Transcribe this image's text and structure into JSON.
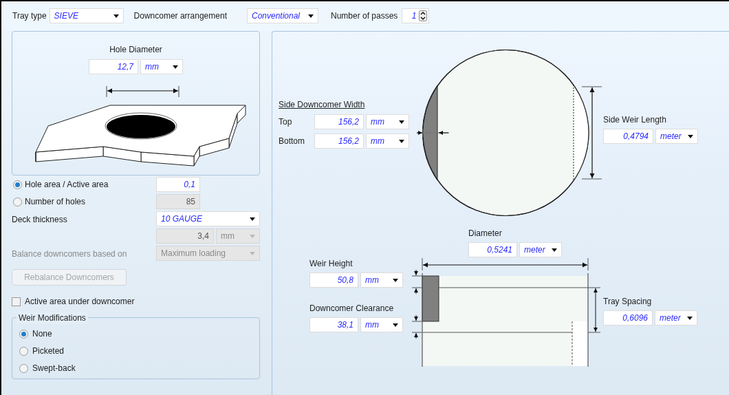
{
  "toolbar": {
    "tray_type": {
      "label": "Tray type",
      "value": "SIEVE"
    },
    "downcomer_arrangement": {
      "label": "Downcomer arrangement",
      "value": "Conventional"
    },
    "number_of_passes": {
      "label": "Number of passes",
      "value": "1"
    }
  },
  "hole_diameter": {
    "label": "Hole Diameter",
    "value": "12,7",
    "unit": "mm"
  },
  "hole_options": [
    {
      "label": "Hole area / Active area",
      "value": "0,1",
      "selected": true,
      "disabled": false
    },
    {
      "label": "Number of holes",
      "value": "85",
      "selected": false,
      "disabled": true
    }
  ],
  "deck_thickness": {
    "label": "Deck thickness",
    "value": "10 GAUGE",
    "thickness": {
      "value": "3,4",
      "unit": "mm",
      "disabled": true
    }
  },
  "balance": {
    "label": "Balance downcomers based on",
    "value": "Maximum loading",
    "disabled": true
  },
  "rebalance_button": {
    "label": "Rebalance Downcomers",
    "disabled": true
  },
  "active_area_under_downcomer": {
    "label": "Active area under downcomer",
    "checked": false
  },
  "weir_modifications": {
    "title": "Weir Modifications",
    "options": [
      {
        "label": "None",
        "selected": true
      },
      {
        "label": "Picketed",
        "selected": false
      },
      {
        "label": "Swept-back",
        "selected": false
      }
    ]
  },
  "side_downcomer_width": {
    "title": "Side Downcomer Width",
    "rows": [
      {
        "label": "Top",
        "value": "156,2",
        "unit": "mm"
      },
      {
        "label": "Bottom",
        "value": "156,2",
        "unit": "mm"
      }
    ]
  },
  "side_weir_length": {
    "label": "Side Weir Length",
    "value": "0,4794",
    "unit": "meter"
  },
  "diameter": {
    "label": "Diameter",
    "value": "0,5241",
    "unit": "meter"
  },
  "weir_height": {
    "label": "Weir Height",
    "value": "50,8",
    "unit": "mm"
  },
  "downcomer_clearance": {
    "label": "Downcomer Clearance",
    "value": "38,1",
    "unit": "mm"
  },
  "tray_spacing": {
    "label": "Tray Spacing",
    "value": "0,6096",
    "unit": "meter"
  }
}
